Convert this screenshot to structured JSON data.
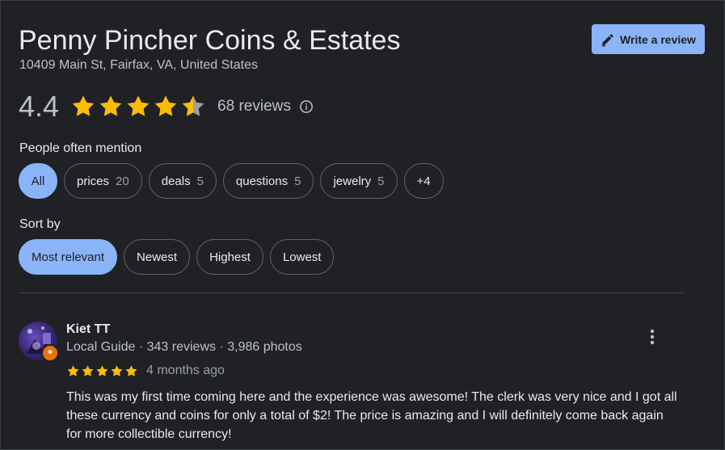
{
  "business": {
    "name": "Penny Pincher Coins & Estates",
    "address": "10409 Main St, Fairfax, VA, United States"
  },
  "write_review": {
    "label": "Write a review",
    "icon": "pencil-icon"
  },
  "rating": {
    "value": "4.4",
    "stars": 4.5,
    "reviews_label": "68 reviews",
    "star_color": "#fbbc04"
  },
  "mentions": {
    "label": "People often mention",
    "chips": [
      {
        "label": "All",
        "count": "",
        "selected": true
      },
      {
        "label": "prices",
        "count": "20",
        "selected": false
      },
      {
        "label": "deals",
        "count": "5",
        "selected": false
      },
      {
        "label": "questions",
        "count": "5",
        "selected": false
      },
      {
        "label": "jewelry",
        "count": "5",
        "selected": false
      },
      {
        "label": "+4",
        "count": "",
        "selected": false
      }
    ]
  },
  "sort": {
    "label": "Sort by",
    "options": [
      {
        "label": "Most relevant",
        "selected": true
      },
      {
        "label": "Newest",
        "selected": false
      },
      {
        "label": "Highest",
        "selected": false
      },
      {
        "label": "Lowest",
        "selected": false
      }
    ]
  },
  "review": {
    "author": "Kiet TT",
    "badge": "Local Guide",
    "review_count": "343 reviews",
    "photo_count": "3,986 photos",
    "separator": "·",
    "stars": 5,
    "date": "4 months ago",
    "text": "This was my first time coming here and the experience was awesome! The clerk was very nice and I got all these currency and coins for only a total of $2! The price is amazing and I will definitely come back again for more collectible currency!"
  },
  "colors": {
    "background": "#202124",
    "accent": "#8ab4f8",
    "star": "#fbbc04",
    "local_guide_badge": "#e8710a"
  }
}
